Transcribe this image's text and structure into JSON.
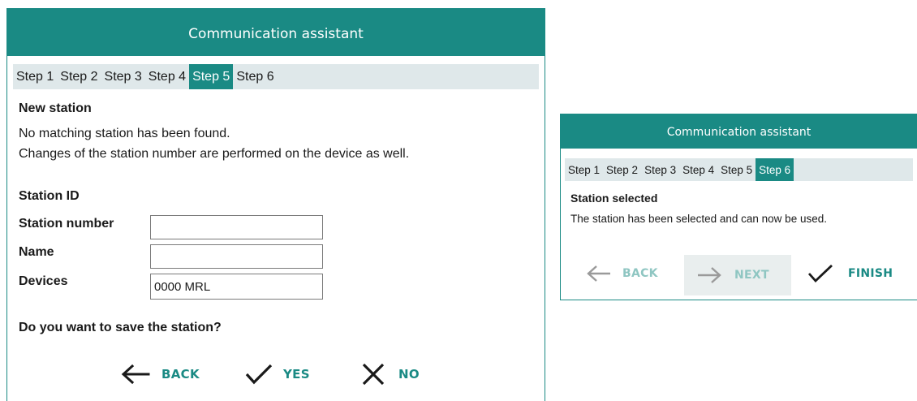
{
  "dialog_left": {
    "title": "Communication assistant",
    "steps": [
      "Step 1",
      "Step 2",
      "Step 3",
      "Step 4",
      "Step 5",
      "Step 6"
    ],
    "active_step": "Step 5",
    "heading": "New station",
    "message_line1": "No matching station has been found.",
    "message_line2": "Changes of the station number are performed on the device as well.",
    "section_title": "Station ID",
    "fields": {
      "station_number_label": "Station number",
      "station_number_value": "",
      "name_label": "Name",
      "name_value": "",
      "devices_label": "Devices",
      "devices_value": "0000 MRL"
    },
    "question": "Do you want to save the station?",
    "buttons": {
      "back": "BACK",
      "yes": "YES",
      "no": "NO"
    }
  },
  "dialog_right": {
    "title": "Communication assistant",
    "steps": [
      "Step 1",
      "Step 2",
      "Step 3",
      "Step 4",
      "Step 5",
      "Step 6"
    ],
    "active_step": "Step 6",
    "heading": "Station selected",
    "message": "The station has been selected and can now be used.",
    "buttons": {
      "back": "BACK",
      "next": "NEXT",
      "finish": "FINISH"
    }
  },
  "colors": {
    "accent": "#1a8a84",
    "step_bar": "#dfe8ea",
    "disabled_text": "#8fc6c2",
    "disabled_bg": "#e9eeee"
  },
  "icons": {
    "back": "arrow-left-icon",
    "next": "arrow-right-icon",
    "yes": "check-icon",
    "finish": "check-icon",
    "no": "x-icon"
  }
}
